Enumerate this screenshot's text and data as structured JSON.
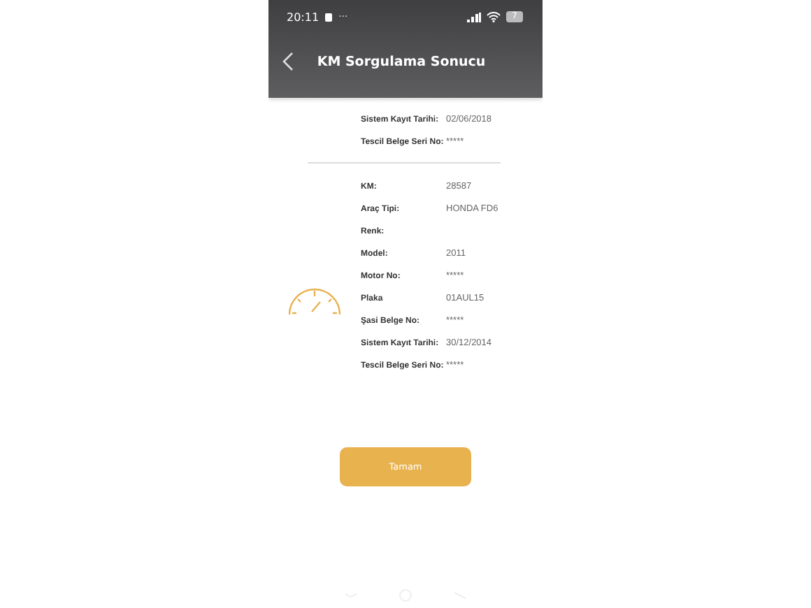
{
  "status_bar": {
    "time": "20:11",
    "dots": "···",
    "battery": "7"
  },
  "header": {
    "title": "KM Sorgulama Sonucu"
  },
  "records": [
    {
      "partial": true,
      "fields": [
        {
          "label": "Sistem Kayıt Tarihi:",
          "value": "02/06/2018"
        },
        {
          "label": "Tescil Belge Seri No:",
          "value": "*****"
        }
      ]
    },
    {
      "partial": false,
      "fields": [
        {
          "label": "KM:",
          "value": "28587"
        },
        {
          "label": "Araç Tipi:",
          "value": "HONDA FD6"
        },
        {
          "label": "Renk:"
        },
        {
          "label": "Model:",
          "value": "2011"
        },
        {
          "label": "Motor No:",
          "value": "*****"
        },
        {
          "label": "Plaka",
          "value": "01AUL15"
        },
        {
          "label": "Şasi Belge No:",
          "value": "*****"
        },
        {
          "label": "Sistem Kayıt Tarihi:",
          "value": "30/12/2014"
        },
        {
          "label": "Tescil Belge Seri No:",
          "value": "*****"
        }
      ]
    }
  ],
  "button": {
    "label": "Tamam"
  }
}
